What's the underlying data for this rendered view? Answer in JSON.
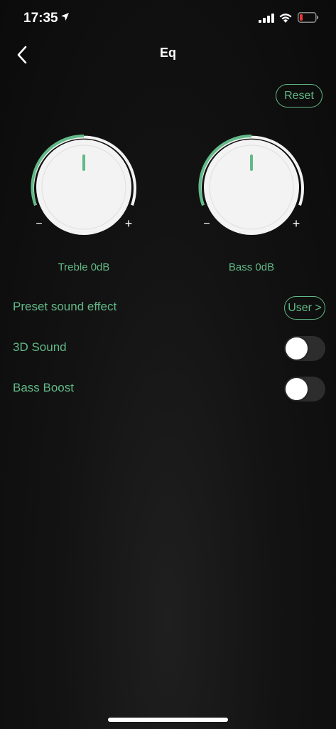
{
  "status_bar": {
    "time": "17:35",
    "icons": [
      "location-arrow-icon",
      "signal-icon",
      "wifi-icon",
      "battery-low-icon"
    ]
  },
  "nav": {
    "title": "Eq",
    "back_icon": "chevron-left-icon"
  },
  "reset_label": "Reset",
  "knobs": [
    {
      "name": "treble",
      "label": "Treble 0dB",
      "minus": "−",
      "plus": "+",
      "level": 0.5
    },
    {
      "name": "bass",
      "label": "Bass 0dB",
      "minus": "−",
      "plus": "+",
      "level": 0.5
    }
  ],
  "settings": {
    "preset": {
      "label": "Preset sound effect",
      "value": "User >"
    },
    "sound3d": {
      "label": "3D Sound",
      "enabled": false
    },
    "bass_boost": {
      "label": "Bass Boost",
      "enabled": false
    }
  },
  "colors": {
    "accent": "#62b987",
    "background": "#0b0b0b",
    "toggle_off": "#2d2d2d"
  }
}
